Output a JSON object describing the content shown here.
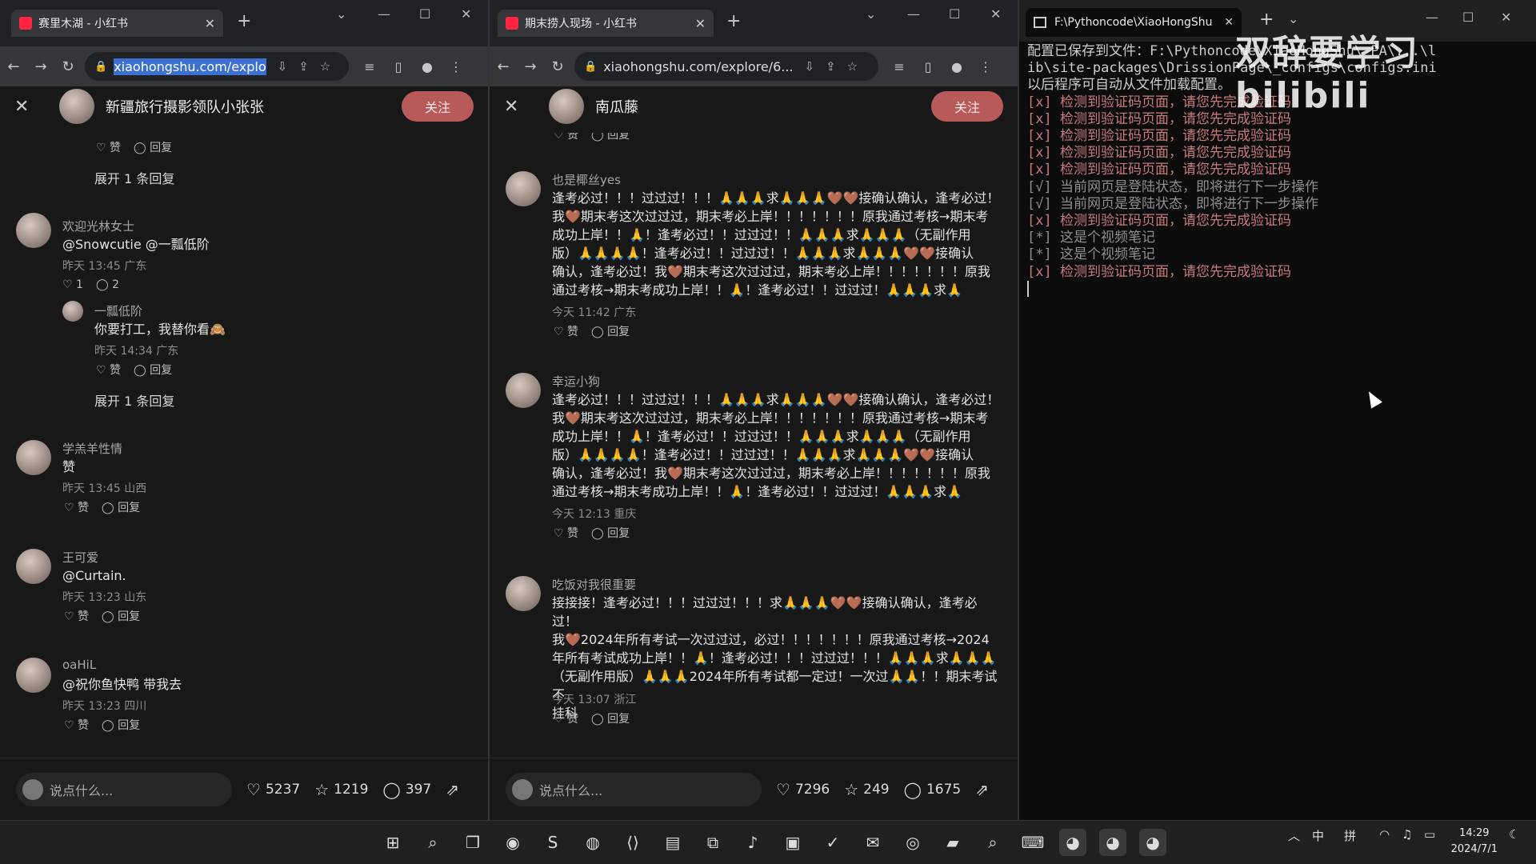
{
  "browser1": {
    "tab_title": "赛里木湖 - 小红书",
    "url": "xiaohongshu.com/explo",
    "author": "新疆旅行摄影领队小张张",
    "follow": "关注",
    "top_actions": {
      "like": "赞",
      "reply": "回复"
    },
    "expand_top": "展开 1 条回复",
    "comments": [
      {
        "name": "欢迎光林女士",
        "text": "@Snowcutie @一瓢低阶",
        "meta": "昨天 13:45 广东",
        "likes": "1",
        "replies": "2"
      },
      {
        "name": "一瓢低阶",
        "text": "你要打工，我替你看🙈",
        "meta": "昨天 14:34 广东",
        "likes": "赞",
        "replies": "回复",
        "expand": "展开 1 条回复"
      },
      {
        "name": "学羔羊性情",
        "text": "赞",
        "meta": "昨天 13:45 山西",
        "likes": "赞",
        "replies": "回复"
      },
      {
        "name": "王可爱",
        "text": "@Curtain.",
        "meta": "昨天 13:23 山东",
        "likes": "赞",
        "replies": "回复"
      },
      {
        "name": "oaHiL",
        "text": "@祝你鱼快鸭 带我去",
        "meta": "昨天 13:23 四川",
        "likes": "赞",
        "replies": "回复"
      }
    ],
    "say_placeholder": "说点什么...",
    "stats": {
      "likes": "5237",
      "stars": "1219",
      "comments": "397"
    }
  },
  "browser2": {
    "tab_title": "期末捞人现场 - 小红书",
    "url": "xiaohongshu.com/explore/6...",
    "author": "南瓜藤",
    "follow": "关注",
    "top_actions": {
      "like": "赞",
      "reply": "回复"
    },
    "comments": [
      {
        "name": "也是椰丝yes",
        "lines": [
          "逢考必过！！！过过过！！！🙏🙏🙏求🙏🙏🙏🤎🤎接确认确认，逢考必过！",
          "我🤎期末考这次过过过，期末考必上岸！！！！！！！原我通过考核→期末考",
          "成功上岸！！🙏！逢考必过！！过过过！！🙏🙏🙏求🙏🙏🙏（无副作用",
          "版）🙏🙏🙏🙏！逢考必过！！过过过！！🙏🙏🙏求🙏🙏🙏🤎🤎接确认",
          "确认，逢考必过！我🤎期末考这次过过过，期末考必上岸！！！！！！！原我",
          "通过考核→期末考成功上岸！！🙏！逢考必过！！过过过！🙏🙏🙏求🙏"
        ],
        "meta": "今天 11:42 广东",
        "like": "赞",
        "reply": "回复"
      },
      {
        "name": "幸运小狗",
        "lines": [
          "逢考必过！！！过过过！！！🙏🙏🙏求🙏🙏🙏🤎🤎接确认确认，逢考必过！",
          "我🤎期末考这次过过过，期末考必上岸！！！！！！！原我通过考核→期末考",
          "成功上岸！！🙏！逢考必过！！过过过！！🙏🙏🙏求🙏🙏🙏（无副作用",
          "版）🙏🙏🙏🙏！逢考必过！！过过过！！🙏🙏🙏求🙏🙏🙏🤎🤎接确认",
          "确认，逢考必过！我🤎期末考这次过过过，期末考必上岸！！！！！！！原我",
          "通过考核→期末考成功上岸！！🙏！逢考必过！！过过过！🙏🙏🙏求🙏"
        ],
        "meta": "今天 12:13 重庆",
        "like": "赞",
        "reply": "回复"
      },
      {
        "name": "吃饭对我很重要",
        "lines": [
          "接接接！逢考必过！！！过过过！！！求🙏🙏🙏🤎🤎接确认确认，逢考必过！",
          "我🤎2024年所有考试一次过过过，必过！！！！！！！原我通过考核→2024",
          "年所有考试成功上岸！！🙏！逢考必过！！！过过过！！！🙏🙏🙏求🙏🙏🙏",
          "（无副作用版）🙏🙏🙏2024年所有考试都一定过！一次过🙏🙏！！期末考试不",
          "挂科"
        ],
        "meta": "今天 13:07 浙江",
        "like": "赞",
        "reply": "回复"
      }
    ],
    "say_placeholder": "说点什么...",
    "stats": {
      "likes": "7296",
      "stars": "249",
      "comments": "1675"
    }
  },
  "terminal": {
    "tab_title": "F:\\Pythoncode\\XiaoHongShu",
    "lines": [
      {
        "t": "配置已保存到文件：F:\\Pythoncode\\XiaoHongShu\\_PA\\...\\l",
        "k": "n"
      },
      {
        "t": "ib\\site-packages\\DrissionPage\\_configs\\configs.ini",
        "k": "n"
      },
      {
        "t": "以后程序可自动从文件加载配置。",
        "k": "n"
      },
      {
        "t": "[x] 检测到验证码页面，请您先完成验证码",
        "k": "x"
      },
      {
        "t": "[x] 检测到验证码页面，请您先完成验证码",
        "k": "x"
      },
      {
        "t": "[x] 检测到验证码页面，请您先完成验证码",
        "k": "x"
      },
      {
        "t": "[x] 检测到验证码页面，请您先完成验证码",
        "k": "x"
      },
      {
        "t": "[x] 检测到验证码页面，请您先完成验证码",
        "k": "x"
      },
      {
        "t": "[√] 当前网页是登陆状态，即将进行下一步操作",
        "k": "o"
      },
      {
        "t": "[√] 当前网页是登陆状态，即将进行下一步操作",
        "k": "o"
      },
      {
        "t": "[x] 检测到验证码页面，请您先完成验证码",
        "k": "x"
      },
      {
        "t": "[*] 这是个视频笔记",
        "k": "o"
      },
      {
        "t": "[*] 这是个视频笔记",
        "k": "o"
      },
      {
        "t": "[x] 检测到验证码页面，请您先完成验证码",
        "k": "x"
      }
    ],
    "watermark": "双辞要学习 bilibili"
  },
  "taskbar": {
    "ime1": "中",
    "ime2": "拼",
    "time": "14:29",
    "date": "2024/7/1"
  }
}
